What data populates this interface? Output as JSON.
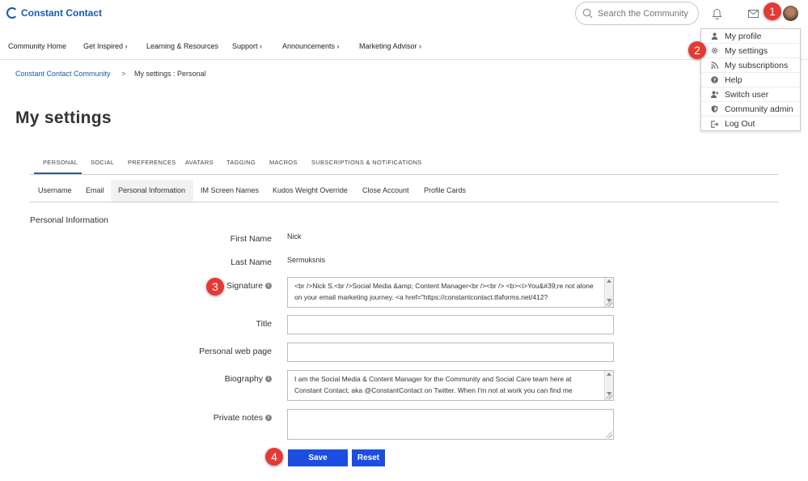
{
  "header": {
    "logo_text": "Constant Contact",
    "search_placeholder": "Search the Community"
  },
  "nav": {
    "items": [
      "Community Home",
      "Get Inspired",
      "Learning & Resources",
      "Support",
      "Announcements",
      "Marketing Advisor"
    ]
  },
  "breadcrumb": {
    "home": "Constant Contact Community",
    "separator": ">",
    "current": "My settings : Personal"
  },
  "page_title": "My settings",
  "user_menu": {
    "items": [
      "My profile",
      "My settings",
      "My subscriptions",
      "Help",
      "Switch user",
      "Community admin",
      "Log Out"
    ]
  },
  "tabs_primary": [
    "PERSONAL",
    "SOCIAL",
    "PREFERENCES",
    "AVATARS",
    "TAGGING",
    "MACROS",
    "SUBSCRIPTIONS & NOTIFICATIONS"
  ],
  "tabs_secondary": [
    "Username",
    "Email",
    "Personal Information",
    "IM Screen Names",
    "Kudos Weight Override",
    "Close Account",
    "Profile Cards"
  ],
  "section_title": "Personal Information",
  "form": {
    "first_name_label": "First Name",
    "first_name_value": "Nick",
    "last_name_label": "Last Name",
    "last_name_value": "Sermuksnis",
    "signature_label": "Signature",
    "signature_value": "<br />Nick S.<br />Social Media &amp; Content Manager<br /><br /> <b><i>You&#39;re not alone on your email marketing journey. <a href=\"https://constantcontact.tfaforms.net/412?",
    "title_label": "Title",
    "title_value": "",
    "web_page_label": "Personal web page",
    "web_page_value": "",
    "biography_label": "Biography",
    "biography_value": "I am the Social Media & Content Manager for the Community and Social Care team here at Constant Contact, aka @ConstantContact on Twitter. When I'm not at work you can find me",
    "private_notes_label": "Private notes",
    "private_notes_value": "",
    "save_label": "Save",
    "reset_label": "Reset"
  },
  "annotations": [
    "1",
    "2",
    "3",
    "4"
  ],
  "colors": {
    "brand": "#1a5ba6",
    "button": "#1c4fe0",
    "badge": "#e53935",
    "tab_underline": "#2f5f88"
  }
}
